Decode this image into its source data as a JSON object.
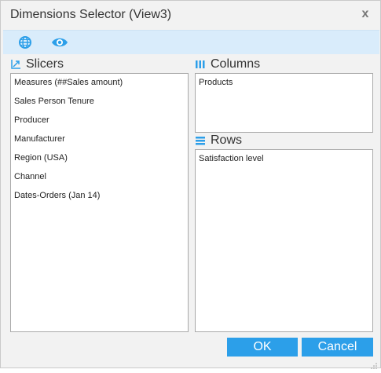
{
  "dialog": {
    "title": "Dimensions Selector (View3)",
    "close_label": "x"
  },
  "toolbar": {
    "items": [
      {
        "icon": "globe-icon"
      },
      {
        "icon": "eye-icon"
      }
    ]
  },
  "slicers": {
    "label": "Slicers",
    "icon": "slicers-icon",
    "items": [
      "Measures (##Sales amount)",
      "Sales Person Tenure",
      "Producer",
      "Manufacturer",
      "Region (USA)",
      "Channel",
      "Dates-Orders (Jan 14)"
    ]
  },
  "columns": {
    "label": "Columns",
    "icon": "columns-icon",
    "items": [
      "Products"
    ]
  },
  "rows": {
    "label": "Rows",
    "icon": "rows-icon",
    "items": [
      "Satisfaction level"
    ]
  },
  "buttons": {
    "ok_label": "OK",
    "cancel_label": "Cancel"
  },
  "colors": {
    "accent": "#2c9fe9",
    "toolbar_bg": "#d9ecfb",
    "dialog_bg": "#f2f2f2"
  }
}
